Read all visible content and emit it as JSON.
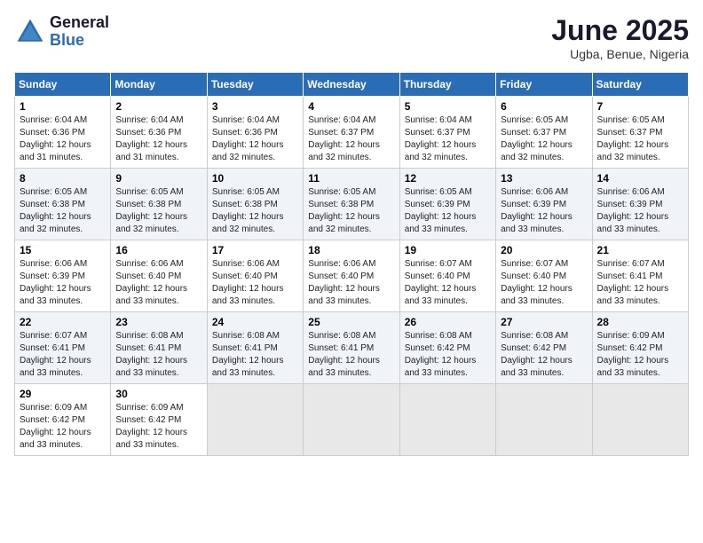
{
  "header": {
    "logo_general": "General",
    "logo_blue": "Blue",
    "month_title": "June 2025",
    "location": "Ugba, Benue, Nigeria"
  },
  "weekdays": [
    "Sunday",
    "Monday",
    "Tuesday",
    "Wednesday",
    "Thursday",
    "Friday",
    "Saturday"
  ],
  "weeks": [
    [
      {
        "day": "1",
        "sunrise": "6:04 AM",
        "sunset": "6:36 PM",
        "daylight": "12 hours and 31 minutes."
      },
      {
        "day": "2",
        "sunrise": "6:04 AM",
        "sunset": "6:36 PM",
        "daylight": "12 hours and 31 minutes."
      },
      {
        "day": "3",
        "sunrise": "6:04 AM",
        "sunset": "6:36 PM",
        "daylight": "12 hours and 32 minutes."
      },
      {
        "day": "4",
        "sunrise": "6:04 AM",
        "sunset": "6:37 PM",
        "daylight": "12 hours and 32 minutes."
      },
      {
        "day": "5",
        "sunrise": "6:04 AM",
        "sunset": "6:37 PM",
        "daylight": "12 hours and 32 minutes."
      },
      {
        "day": "6",
        "sunrise": "6:05 AM",
        "sunset": "6:37 PM",
        "daylight": "12 hours and 32 minutes."
      },
      {
        "day": "7",
        "sunrise": "6:05 AM",
        "sunset": "6:37 PM",
        "daylight": "12 hours and 32 minutes."
      }
    ],
    [
      {
        "day": "8",
        "sunrise": "6:05 AM",
        "sunset": "6:38 PM",
        "daylight": "12 hours and 32 minutes."
      },
      {
        "day": "9",
        "sunrise": "6:05 AM",
        "sunset": "6:38 PM",
        "daylight": "12 hours and 32 minutes."
      },
      {
        "day": "10",
        "sunrise": "6:05 AM",
        "sunset": "6:38 PM",
        "daylight": "12 hours and 32 minutes."
      },
      {
        "day": "11",
        "sunrise": "6:05 AM",
        "sunset": "6:38 PM",
        "daylight": "12 hours and 32 minutes."
      },
      {
        "day": "12",
        "sunrise": "6:05 AM",
        "sunset": "6:39 PM",
        "daylight": "12 hours and 33 minutes."
      },
      {
        "day": "13",
        "sunrise": "6:06 AM",
        "sunset": "6:39 PM",
        "daylight": "12 hours and 33 minutes."
      },
      {
        "day": "14",
        "sunrise": "6:06 AM",
        "sunset": "6:39 PM",
        "daylight": "12 hours and 33 minutes."
      }
    ],
    [
      {
        "day": "15",
        "sunrise": "6:06 AM",
        "sunset": "6:39 PM",
        "daylight": "12 hours and 33 minutes."
      },
      {
        "day": "16",
        "sunrise": "6:06 AM",
        "sunset": "6:40 PM",
        "daylight": "12 hours and 33 minutes."
      },
      {
        "day": "17",
        "sunrise": "6:06 AM",
        "sunset": "6:40 PM",
        "daylight": "12 hours and 33 minutes."
      },
      {
        "day": "18",
        "sunrise": "6:06 AM",
        "sunset": "6:40 PM",
        "daylight": "12 hours and 33 minutes."
      },
      {
        "day": "19",
        "sunrise": "6:07 AM",
        "sunset": "6:40 PM",
        "daylight": "12 hours and 33 minutes."
      },
      {
        "day": "20",
        "sunrise": "6:07 AM",
        "sunset": "6:40 PM",
        "daylight": "12 hours and 33 minutes."
      },
      {
        "day": "21",
        "sunrise": "6:07 AM",
        "sunset": "6:41 PM",
        "daylight": "12 hours and 33 minutes."
      }
    ],
    [
      {
        "day": "22",
        "sunrise": "6:07 AM",
        "sunset": "6:41 PM",
        "daylight": "12 hours and 33 minutes."
      },
      {
        "day": "23",
        "sunrise": "6:08 AM",
        "sunset": "6:41 PM",
        "daylight": "12 hours and 33 minutes."
      },
      {
        "day": "24",
        "sunrise": "6:08 AM",
        "sunset": "6:41 PM",
        "daylight": "12 hours and 33 minutes."
      },
      {
        "day": "25",
        "sunrise": "6:08 AM",
        "sunset": "6:41 PM",
        "daylight": "12 hours and 33 minutes."
      },
      {
        "day": "26",
        "sunrise": "6:08 AM",
        "sunset": "6:42 PM",
        "daylight": "12 hours and 33 minutes."
      },
      {
        "day": "27",
        "sunrise": "6:08 AM",
        "sunset": "6:42 PM",
        "daylight": "12 hours and 33 minutes."
      },
      {
        "day": "28",
        "sunrise": "6:09 AM",
        "sunset": "6:42 PM",
        "daylight": "12 hours and 33 minutes."
      }
    ],
    [
      {
        "day": "29",
        "sunrise": "6:09 AM",
        "sunset": "6:42 PM",
        "daylight": "12 hours and 33 minutes."
      },
      {
        "day": "30",
        "sunrise": "6:09 AM",
        "sunset": "6:42 PM",
        "daylight": "12 hours and 33 minutes."
      },
      null,
      null,
      null,
      null,
      null
    ]
  ]
}
